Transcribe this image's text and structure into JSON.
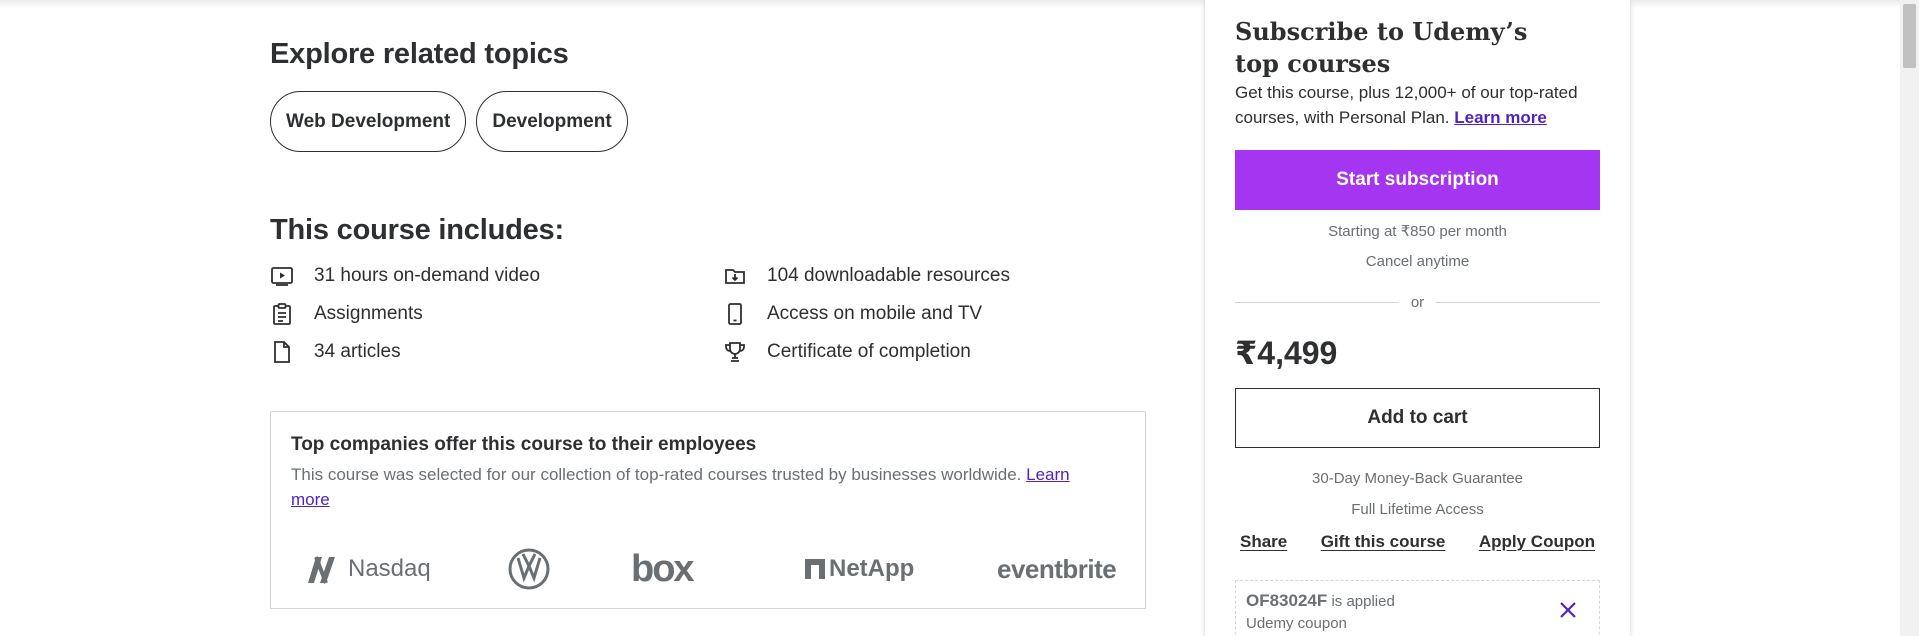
{
  "topics": {
    "title": "Explore related topics",
    "chips": [
      "Web Development",
      "Development"
    ]
  },
  "includes": {
    "title": "This course includes:",
    "items": [
      {
        "icon": "video-icon",
        "label": "31 hours on-demand video"
      },
      {
        "icon": "download-folder-icon",
        "label": "104 downloadable resources"
      },
      {
        "icon": "assignment-icon",
        "label": "Assignments"
      },
      {
        "icon": "mobile-icon",
        "label": "Access on mobile and TV"
      },
      {
        "icon": "file-icon",
        "label": "34 articles"
      },
      {
        "icon": "trophy-icon",
        "label": "Certificate of completion"
      }
    ]
  },
  "companies": {
    "title": "Top companies offer this course to their employees",
    "text": "This course was selected for our collection of top-rated courses trusted by businesses worldwide.",
    "learn_more": "Learn more",
    "logos": [
      "Nasdaq",
      "Volkswagen",
      "box",
      "NetApp",
      "eventbrite"
    ]
  },
  "sidebar": {
    "title": "Subscribe to Udemy’s top courses",
    "desc": "Get this course, plus 12,000+ of our top-rated courses, with Personal Plan.",
    "learn_more": "Learn more",
    "start_button": "Start subscription",
    "starting_at": "Starting at ₹850 per month",
    "cancel": "Cancel anytime",
    "or": "or",
    "price": "₹4,499",
    "add_to_cart": "Add to cart",
    "guarantee": "30-Day Money-Back Guarantee",
    "lifetime": "Full Lifetime Access",
    "share": "Share",
    "gift": "Gift this course",
    "apply_coupon": "Apply Coupon",
    "coupon_code": "OF83024F",
    "coupon_applied": "is applied",
    "coupon_type": "Udemy coupon"
  },
  "colors": {
    "accent": "#a435f0",
    "link": "#5022c3",
    "text": "#2d2f31",
    "muted": "#6a6f73"
  }
}
